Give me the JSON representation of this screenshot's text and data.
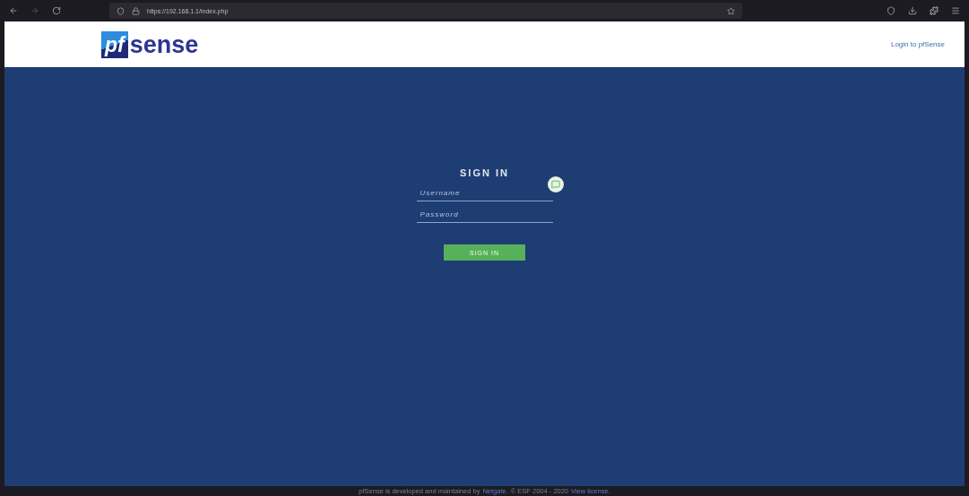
{
  "browser": {
    "url": "https://192.168.1.1/index.php"
  },
  "header": {
    "logo_mark": "pf",
    "logo_text": "sense",
    "link": "Login to pfSense"
  },
  "login": {
    "title": "SIGN IN",
    "fields": [
      {
        "placeholder": "Username"
      },
      {
        "placeholder": "Password"
      }
    ],
    "button": "SIGN IN"
  },
  "footer": {
    "text": "pfSense is developed and maintained by",
    "link": "Netgate.",
    "rest": "© ESF 2004 - 2020",
    "license": "View license."
  }
}
